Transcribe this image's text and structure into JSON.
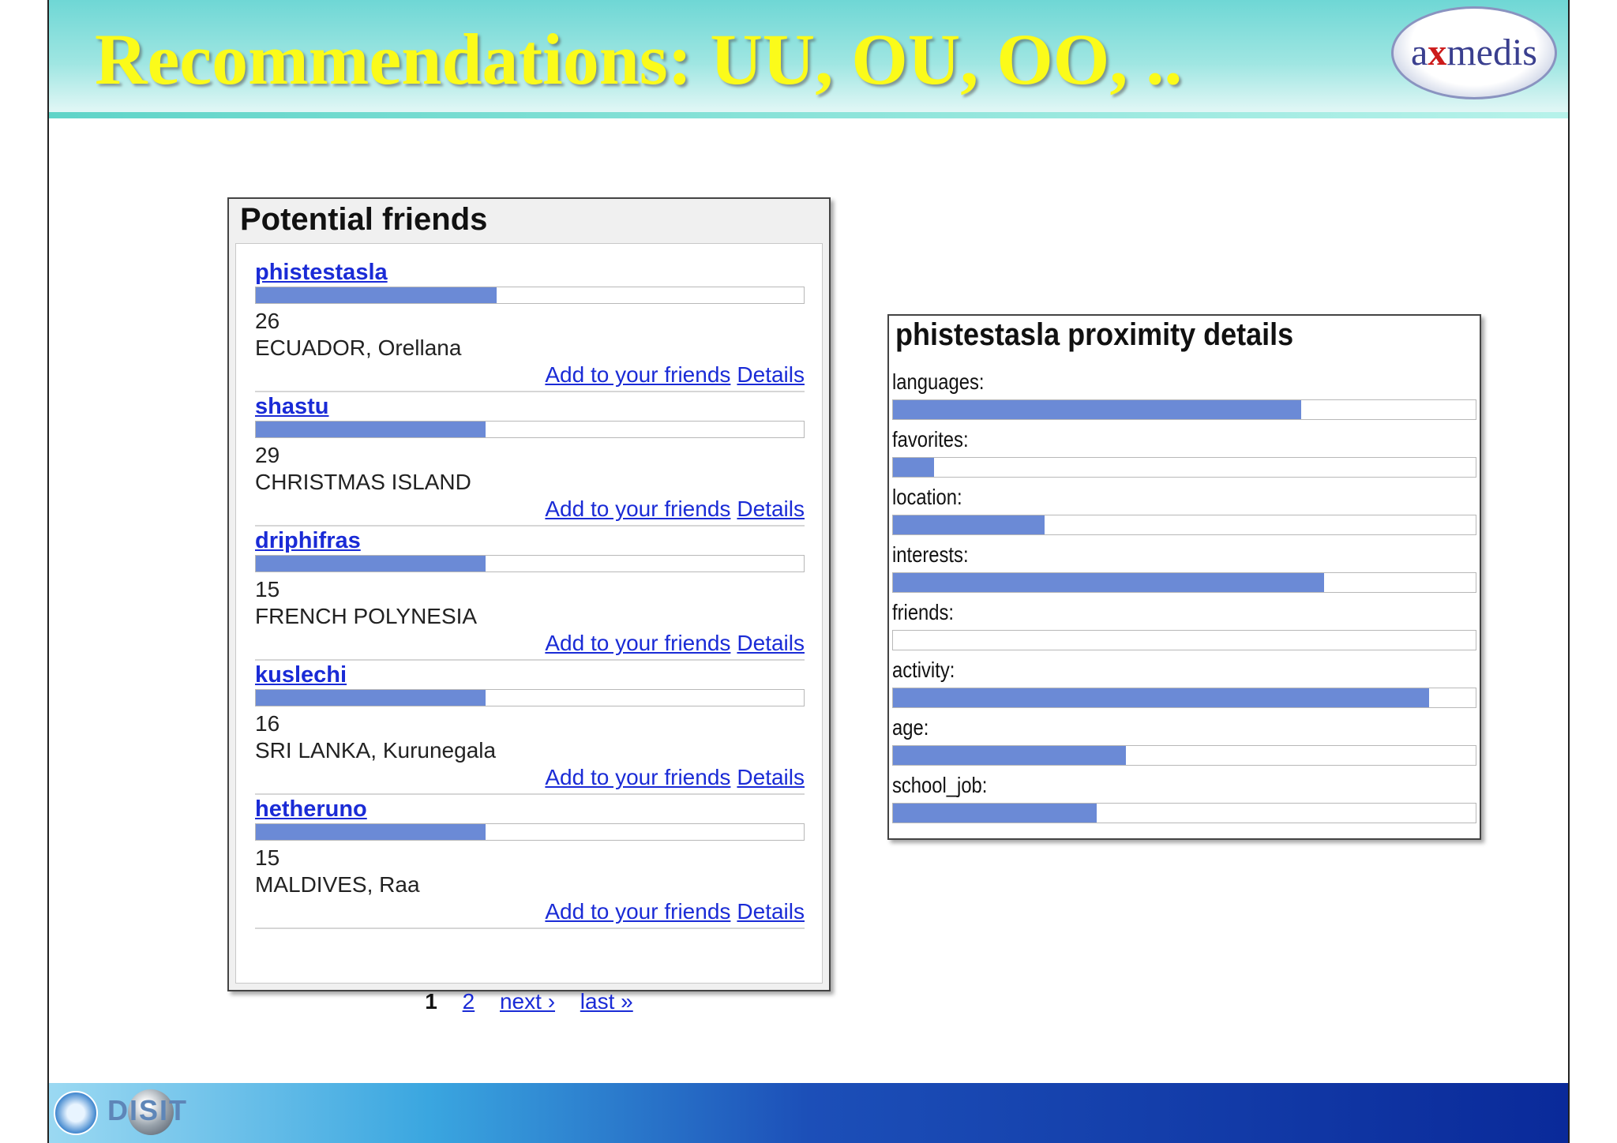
{
  "slide": {
    "title": "Recommendations: UU, OU, OO, ..",
    "logo": {
      "pre": "a",
      "x": "x",
      "post": "medis"
    },
    "footer_text": "DISIT"
  },
  "colors": {
    "bar": "#6b8ad6",
    "link": "#1a2bd6",
    "title": "#fbfb1a"
  },
  "friends_panel": {
    "title": "Potential friends",
    "add_label": "Add to your friends",
    "details_label": "Details",
    "friends": [
      {
        "name": "phistestasla",
        "age": "26",
        "location": "ECUADOR, Orellana",
        "match": 0.44
      },
      {
        "name": "shastu",
        "age": "29",
        "location": "CHRISTMAS ISLAND",
        "match": 0.42
      },
      {
        "name": "driphifras",
        "age": "15",
        "location": "FRENCH POLYNESIA",
        "match": 0.42
      },
      {
        "name": "kuslechi",
        "age": "16",
        "location": "SRI LANKA, Kurunegala",
        "match": 0.42
      },
      {
        "name": "hetheruno",
        "age": "15",
        "location": "MALDIVES, Raa",
        "match": 0.42
      }
    ],
    "pager": {
      "current": "1",
      "page2": "2",
      "next": "next ›",
      "last": "last »"
    }
  },
  "proximity": {
    "title": "phistestasla proximity details",
    "rows": [
      {
        "label": "languages:",
        "value": 0.7
      },
      {
        "label": "favorites:",
        "value": 0.07
      },
      {
        "label": "location:",
        "value": 0.26
      },
      {
        "label": "interests:",
        "value": 0.74
      },
      {
        "label": "friends:",
        "value": 0.0
      },
      {
        "label": "activity:",
        "value": 0.92
      },
      {
        "label": "age:",
        "value": 0.4
      },
      {
        "label": "school_job:",
        "value": 0.35
      }
    ]
  }
}
